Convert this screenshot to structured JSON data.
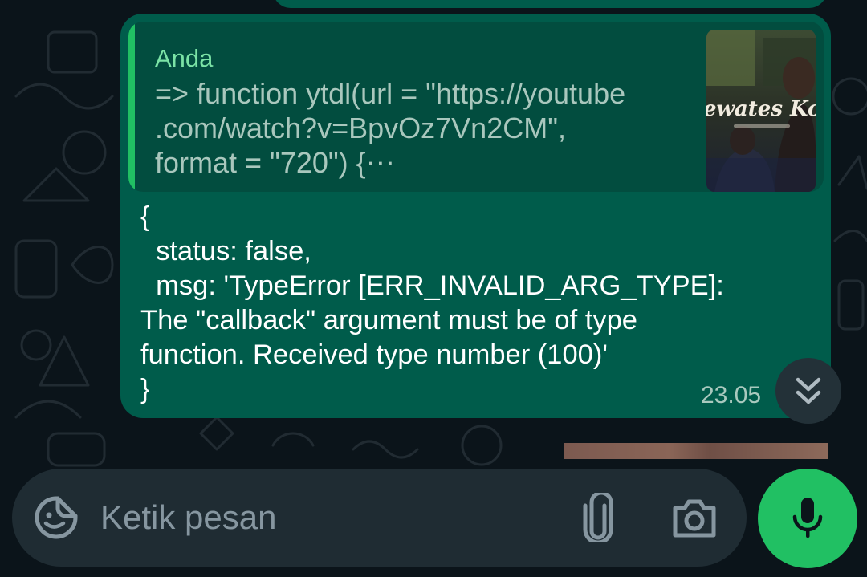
{
  "quoted_message": {
    "author": "Anda",
    "text": "=> function ytdl(url = \"https://youtube\n.com/watch?v=BpvOz7Vn2CM\",\nformat = \"720\") {⋯",
    "thumbnail_caption": "ewates Kon"
  },
  "message": {
    "text": "{\n  status: false,\n  msg: 'TypeError [ERR_INVALID_ARG_TYPE]:\nThe \"callback\" argument must be of type\nfunction. Received type number (100)'\n}",
    "time": "23.05"
  },
  "composer": {
    "placeholder": "Ketik pesan"
  },
  "colors": {
    "background": "#0b141a",
    "outgoing_bubble": "#005c4b",
    "quote_bar": "#21c063",
    "composer": "#1f2c33",
    "mic_button": "#21c063"
  },
  "icons": {
    "emoji": "sticker-smiley-icon",
    "attach": "paperclip-icon",
    "camera": "camera-icon",
    "mic": "microphone-icon",
    "scroll": "double-chevron-down-icon"
  }
}
